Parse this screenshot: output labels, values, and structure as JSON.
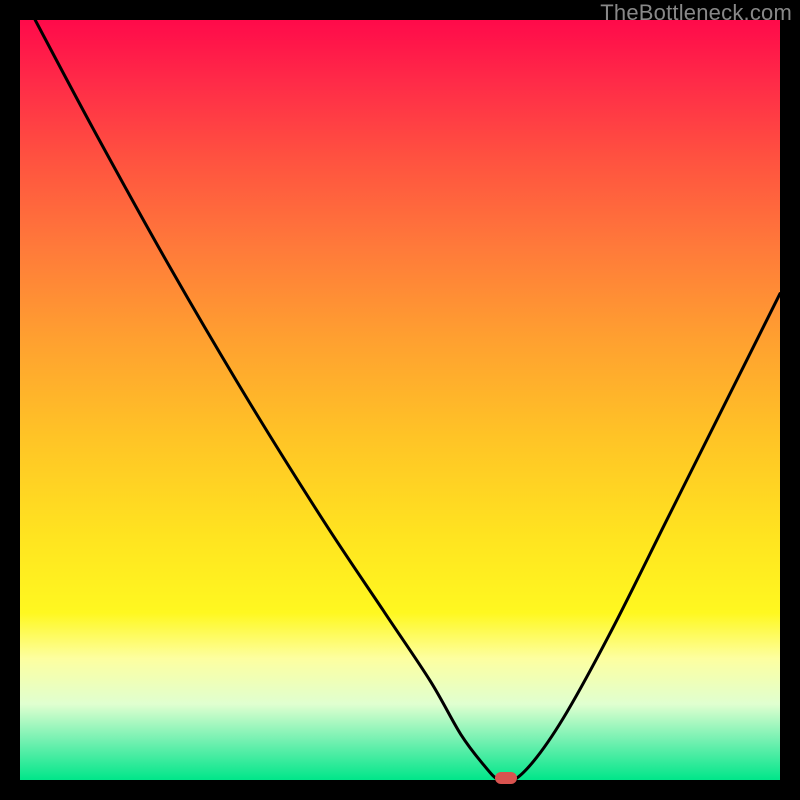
{
  "watermark": "TheBottleneck.com",
  "chart_data": {
    "type": "line",
    "title": "",
    "xlabel": "",
    "ylabel": "",
    "xlim": [
      0,
      100
    ],
    "ylim": [
      0,
      100
    ],
    "series": [
      {
        "name": "bottleneck-curve",
        "x": [
          2,
          10,
          20,
          30,
          40,
          48,
          54,
          58,
          61,
          63,
          65,
          68,
          72,
          78,
          85,
          92,
          100
        ],
        "values": [
          100,
          85,
          67,
          50,
          34,
          22,
          13,
          6,
          2,
          0,
          0,
          3,
          9,
          20,
          34,
          48,
          64
        ]
      }
    ],
    "marker": {
      "x": 64,
      "y": 0
    },
    "background_gradient": {
      "top_color": "#ff0a4a",
      "bottom_color": "#00e68a"
    }
  }
}
